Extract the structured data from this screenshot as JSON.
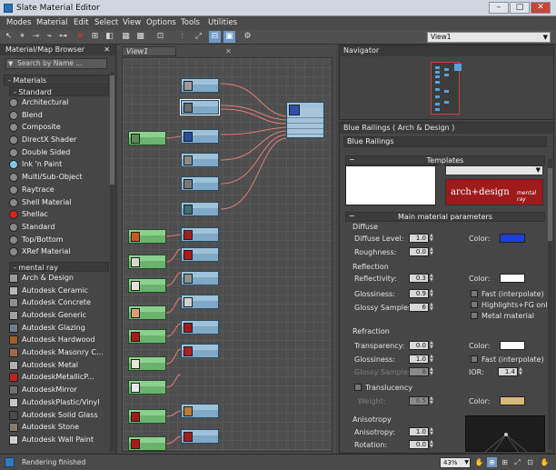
{
  "window": {
    "title": "Slate Material Editor"
  },
  "menu": [
    "Modes",
    "Material",
    "Edit",
    "Select",
    "View",
    "Options",
    "Tools",
    "Utilities"
  ],
  "toolbar": {
    "view_select": "View1"
  },
  "browser": {
    "title": "Material/Map Browser",
    "search_placeholder": "Search by Name ...",
    "materials_label": "- Materials",
    "standard_label": "- Standard",
    "standard_items": [
      {
        "label": "Architectural",
        "color": "#8a8a8a"
      },
      {
        "label": "Blend",
        "color": "#8a8a8a"
      },
      {
        "label": "Composite",
        "color": "#8a8a8a"
      },
      {
        "label": "DirectX Shader",
        "color": "#8a8a8a"
      },
      {
        "label": "Double Sided",
        "color": "#8a8a8a"
      },
      {
        "label": "Ink 'n Paint",
        "color": "#7ec8ee"
      },
      {
        "label": "Multi/Sub-Object",
        "color": "#8a8a8a"
      },
      {
        "label": "Raytrace",
        "color": "#8a8a8a"
      },
      {
        "label": "Shell Material",
        "color": "#8a8a8a"
      },
      {
        "label": "Shellac",
        "color": "#d82020"
      },
      {
        "label": "Standard",
        "color": "#8a8a8a"
      },
      {
        "label": "Top/Bottom",
        "color": "#8a8a8a"
      },
      {
        "label": "XRef Material",
        "color": "#8a8a8a"
      }
    ],
    "mentalray_label": "- mental ray",
    "mentalray_items": [
      {
        "label": "Arch & Design",
        "color": "#9a9a9a"
      },
      {
        "label": "Autodesk Ceramic",
        "color": "#b8b8b8"
      },
      {
        "label": "Autodesk Concrete",
        "color": "#8f8f8f"
      },
      {
        "label": "Autodesk Generic",
        "color": "#a0a0a0"
      },
      {
        "label": "Autodesk Glazing",
        "color": "#6c7f8f"
      },
      {
        "label": "Autodesk Hardwood",
        "color": "#a0602a"
      },
      {
        "label": "Autodesk Masonry C...",
        "color": "#9a6a4a"
      },
      {
        "label": "Autodesk Metal",
        "color": "#b0b0b0"
      },
      {
        "label": "AutodeskMetallicP...",
        "color": "#c02020"
      },
      {
        "label": "AutodeskMirror",
        "color": "#707070"
      },
      {
        "label": "AutodeskPlastic/Vinyl",
        "color": "#c8c8c8"
      },
      {
        "label": "Autodesk Solid Glass",
        "color": "#4a4a4a"
      },
      {
        "label": "Autodesk Stone",
        "color": "#8a7a6a"
      },
      {
        "label": "Autodesk Wall Paint",
        "color": "#d0d0d0"
      }
    ]
  },
  "view": {
    "tab": "View1"
  },
  "navigator": {
    "title": "Navigator"
  },
  "props": {
    "title": "Blue Railings  ( Arch & Design )",
    "name": "Blue Railings",
    "templates_label": "Templates",
    "logo_text": "arch+design",
    "logo_sub": "mental ray",
    "main_label": "Main material parameters",
    "diffuse": {
      "group": "Diffuse",
      "level_label": "Diffuse Level:",
      "level": "1.0",
      "rough_label": "Roughness:",
      "rough": "0.0",
      "color_label": "Color:",
      "color": "#1f3fd6"
    },
    "reflection": {
      "group": "Reflection",
      "refl_label": "Reflectivity:",
      "refl": "0.3",
      "gloss_label": "Glossiness:",
      "gloss": "0.9",
      "samples_label": "Glossy Samples:",
      "samples": "6",
      "color_label": "Color:",
      "color": "#ffffff",
      "fast_label": "Fast (interpolate)",
      "hl_label": "Highlights+FG only",
      "metal_label": "Metal material"
    },
    "refraction": {
      "group": "Refraction",
      "trans_label": "Transparency:",
      "trans": "0.0",
      "gloss_label": "Glossiness:",
      "gloss": "1.0",
      "samples_label": "Glossy Samples:",
      "samples": "8",
      "color_label": "Color:",
      "color": "#ffffff",
      "fast_label": "Fast (interpolate)",
      "ior_label": "IOR:",
      "ior": "1.4"
    },
    "translucency": {
      "group": "Translucency",
      "weight_label": "Weight:",
      "weight": "0.5",
      "color_label": "Color:",
      "color": "#d8b878"
    },
    "anisotropy": {
      "group": "Anisotropy",
      "aniso_label": "Anisotropy:",
      "aniso": "1.0",
      "rot_label": "Rotation:",
      "rot": "0.0"
    }
  },
  "status": {
    "text": "Rendering finished",
    "zoom": "43%"
  }
}
